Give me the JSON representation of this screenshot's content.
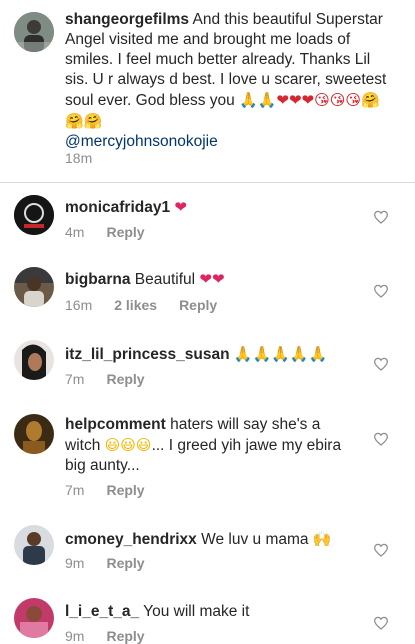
{
  "caption": {
    "username": "shangeorgefilms",
    "text": "And this beautiful Superstar Angel visited me and brought me loads of smiles. I feel much better already. Thanks Lil sis. U r always d best. I love u scarer, sweetest soul ever. God bless you",
    "emojis": "🙏🙏❤❤❤😘😘😘🤗🤗🤗",
    "mention": "@mercyjohnsonokojie",
    "time": "18m"
  },
  "comments": [
    {
      "username": "monicafriday1",
      "text": "",
      "emojis": "❤",
      "time": "4m",
      "likes": "",
      "reply": "Reply"
    },
    {
      "username": "bigbarna",
      "text": "Beautiful",
      "emojis": "❤❤",
      "time": "16m",
      "likes": "2 likes",
      "reply": "Reply"
    },
    {
      "username": "itz_lil_princess_susan",
      "text": "",
      "emojis": "🙏🙏🙏🙏🙏",
      "time": "7m",
      "likes": "",
      "reply": "Reply"
    },
    {
      "username": "helpcomment",
      "text": "haters will say she's a witch",
      "emojis": "😃😃😃",
      "text2": "... I greed yih jawe my ebira big aunty...",
      "time": "7m",
      "likes": "",
      "reply": "Reply"
    },
    {
      "username": "cmoney_hendrixx",
      "text": "We luv u mama",
      "emojis": "🙌",
      "time": "9m",
      "likes": "",
      "reply": "Reply"
    },
    {
      "username": "l_i_e_t_a_",
      "text": "You will make it",
      "emojis": "",
      "time": "9m",
      "likes": "",
      "reply": "Reply"
    }
  ],
  "colors": {
    "accent_mention": "#003569",
    "meta": "#8e8e8e",
    "heart_outline": "#8e8e8e"
  },
  "icons": {
    "like": "heart-outline-icon"
  }
}
